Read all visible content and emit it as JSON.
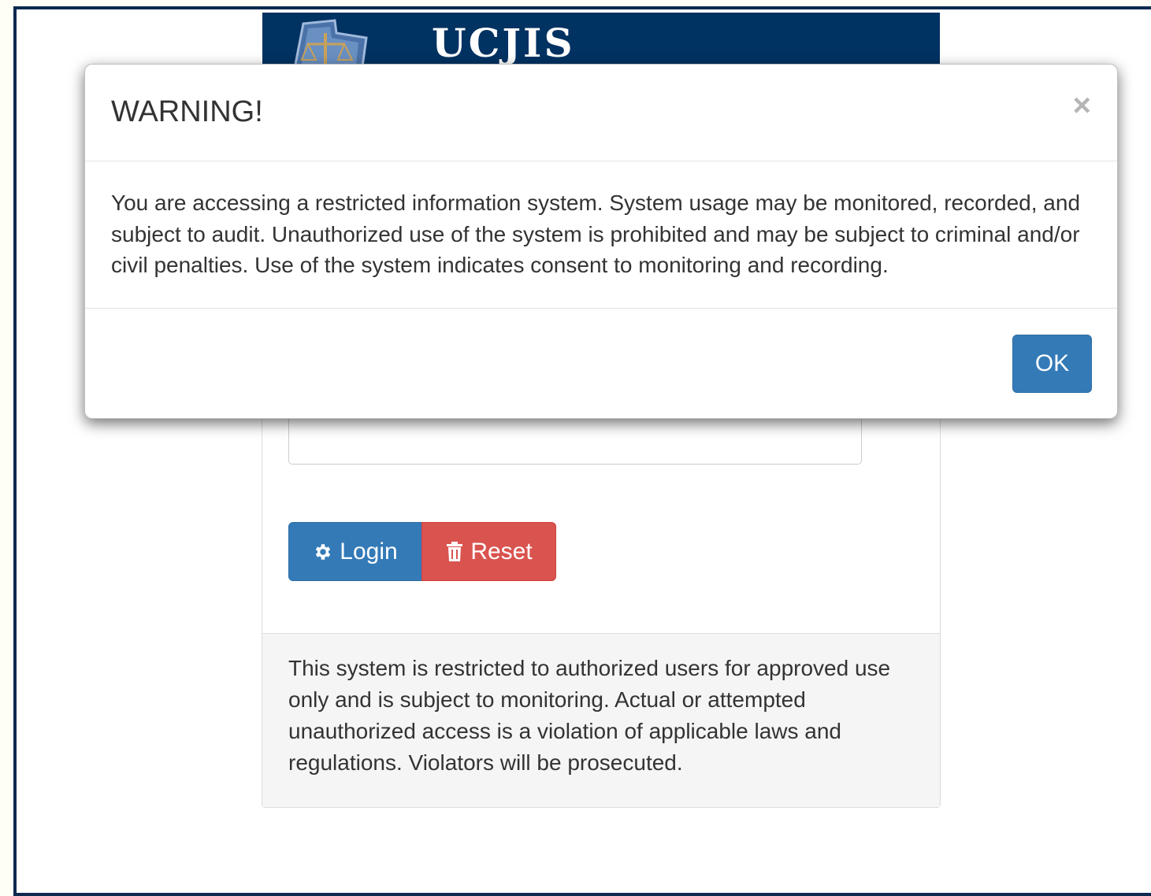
{
  "header": {
    "title": "UCJIS",
    "logo_icon": "scales-of-justice-state-logo"
  },
  "login_form": {
    "login_label": "Login",
    "login_icon": "gear-icon",
    "reset_label": "Reset",
    "reset_icon": "trash-icon"
  },
  "footer": {
    "notice": "This system is restricted to authorized users for approved use only and is subject to monitoring. Actual or attempted unauthorized access is a violation of applicable laws and regulations. Violators will be prosecuted."
  },
  "modal": {
    "title": "WARNING!",
    "close_label": "×",
    "body": "You are accessing a restricted information system. System usage may be monitored, recorded, and subject to audit. Unauthorized use of the system is prohibited and may be subject to criminal and/or civil penalties. Use of the system indicates consent to monitoring and recording.",
    "ok_label": "OK"
  },
  "colors": {
    "banner": "#003262",
    "primary": "#337ab7",
    "danger": "#d9534f",
    "frame_border": "#0e2a4f"
  }
}
